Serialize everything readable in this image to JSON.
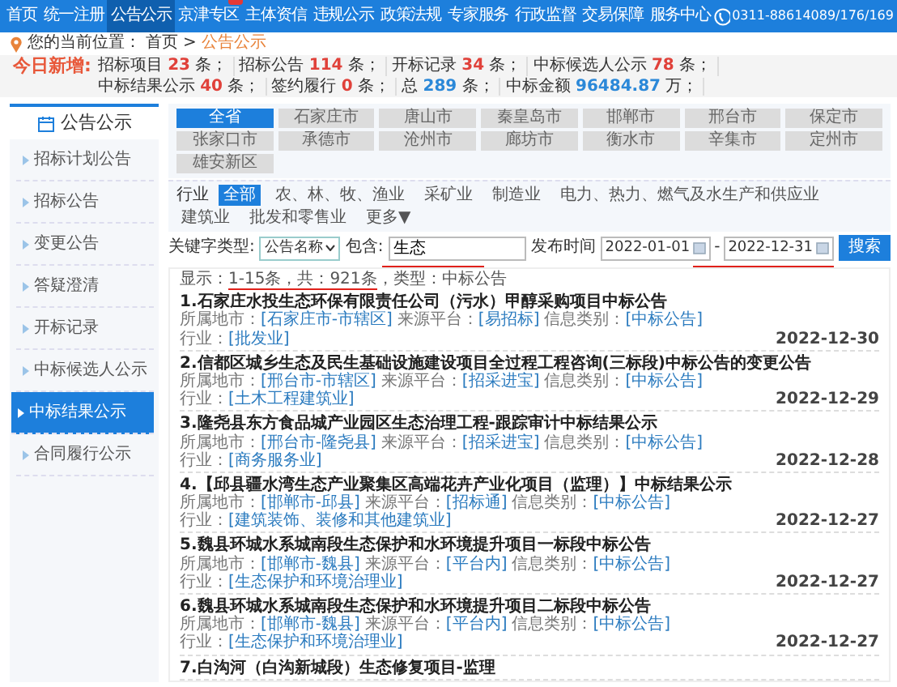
{
  "nav": {
    "items": [
      {
        "label": "首页",
        "selected": false,
        "badge": false
      },
      {
        "label": "统一注册",
        "selected": false,
        "badge": false
      },
      {
        "label": "公告公示",
        "selected": true,
        "badge": false
      },
      {
        "label": "京津专区",
        "selected": false,
        "badge": true
      },
      {
        "label": "主体资信",
        "selected": false,
        "badge": false
      },
      {
        "label": "违规公示",
        "selected": false,
        "badge": false
      },
      {
        "label": "政策法规",
        "selected": false,
        "badge": false
      },
      {
        "label": "专家服务",
        "selected": false,
        "badge": false
      },
      {
        "label": "行政监督",
        "selected": false,
        "badge": false
      },
      {
        "label": "交易保障",
        "selected": false,
        "badge": false
      },
      {
        "label": "服务中心",
        "selected": false,
        "badge": false
      }
    ],
    "phone": "0311-88614089/176/169"
  },
  "breadcrumb": {
    "label": "您的当前位置：",
    "separator": ">",
    "items": [
      {
        "label": "首页",
        "current": false
      },
      {
        "label": "公告公示",
        "current": true
      }
    ]
  },
  "stats": {
    "title": "今日新增:",
    "items": [
      {
        "label": "招标项目",
        "value": "23",
        "unit": "条；",
        "color": "#e0413a"
      },
      {
        "label": "招标公告",
        "value": "114",
        "unit": "条；",
        "color": "#e0413a"
      },
      {
        "label": "开标记录",
        "value": "34",
        "unit": "条；",
        "color": "#e0413a"
      },
      {
        "label": "中标候选人公示",
        "value": "78",
        "unit": "条；",
        "color": "#e0413a"
      },
      {
        "label": "中标结果公示",
        "value": "40",
        "unit": "条；",
        "color": "#e0413a"
      },
      {
        "label": "签约履行",
        "value": "0",
        "unit": "条；",
        "color": "#e0413a"
      },
      {
        "label": "总",
        "value": "289",
        "unit": "条；",
        "color": "#2b88d8"
      },
      {
        "label": "中标金额",
        "value": "96484.87",
        "unit": "万；",
        "color": "#2b88d8"
      }
    ]
  },
  "sidebar": {
    "title": "公告公示",
    "items": [
      {
        "label": "招标计划公告",
        "selected": false
      },
      {
        "label": "招标公告",
        "selected": false
      },
      {
        "label": "变更公告",
        "selected": false
      },
      {
        "label": "答疑澄清",
        "selected": false
      },
      {
        "label": "开标记录",
        "selected": false
      },
      {
        "label": "中标候选人公示",
        "selected": false
      },
      {
        "label": "中标结果公示",
        "selected": true
      },
      {
        "label": "合同履行公示",
        "selected": false
      }
    ]
  },
  "regions": [
    {
      "label": "全省",
      "selected": true
    },
    {
      "label": "石家庄市",
      "selected": false
    },
    {
      "label": "唐山市",
      "selected": false
    },
    {
      "label": "秦皇岛市",
      "selected": false
    },
    {
      "label": "邯郸市",
      "selected": false
    },
    {
      "label": "邢台市",
      "selected": false
    },
    {
      "label": "保定市",
      "selected": false
    },
    {
      "label": "张家口市",
      "selected": false
    },
    {
      "label": "承德市",
      "selected": false
    },
    {
      "label": "沧州市",
      "selected": false
    },
    {
      "label": "廊坊市",
      "selected": false
    },
    {
      "label": "衡水市",
      "selected": false
    },
    {
      "label": "辛集市",
      "selected": false
    },
    {
      "label": "定州市",
      "selected": false
    },
    {
      "label": "雄安新区",
      "selected": false
    }
  ],
  "industry": {
    "label": "行业",
    "more": "更多▼",
    "items": [
      {
        "label": "全部",
        "selected": true
      },
      {
        "label": "农、林、牧、渔业",
        "selected": false
      },
      {
        "label": "采矿业",
        "selected": false
      },
      {
        "label": "制造业",
        "selected": false
      },
      {
        "label": "电力、热力、燃气及水生产和供应业",
        "selected": false
      },
      {
        "label": "建筑业",
        "selected": false
      },
      {
        "label": "批发和零售业",
        "selected": false
      }
    ]
  },
  "search": {
    "keyword_type_label": "关键字类型:",
    "keyword_type": "公告名称",
    "contains_label": "包含:",
    "keyword": "生态",
    "keyword_underlined": true,
    "date_label": "发布时间",
    "date_from": "2022-01-01",
    "date_separator": "-",
    "date_to": "2022-12-31",
    "dates_underlined": true,
    "button": "搜索"
  },
  "results": {
    "summary": {
      "prefix": "显示：",
      "underlined": "1-15条，共：921条",
      "suffix": "，类型：中标公告"
    },
    "items": [
      {
        "title": "1.石家庄水投生态环保有限责任公司（污水）甲醇采购项目中标公告",
        "date": "2022-12-30",
        "meta": [
          {
            "label": "所属地市：",
            "value": "[石家庄市-市辖区]"
          },
          {
            "label": "来源平台：",
            "value": "[易招标]"
          },
          {
            "label": "信息类别：",
            "value": "[中标公告]"
          },
          {
            "label": "行业：",
            "value": "[批发业]"
          }
        ]
      },
      {
        "title": "2.信都区城乡生态及民生基础设施建设项目全过程工程咨询(三标段)中标公告的变更公告",
        "date": "2022-12-29",
        "meta": [
          {
            "label": "所属地市：",
            "value": "[邢台市-市辖区]"
          },
          {
            "label": "来源平台：",
            "value": "[招采进宝]"
          },
          {
            "label": "信息类别：",
            "value": "[中标公告]"
          },
          {
            "label": "行业：",
            "value": "[土木工程建筑业]"
          }
        ]
      },
      {
        "title": "3.隆尧县东方食品城产业园区生态治理工程-跟踪审计中标结果公示",
        "date": "2022-12-28",
        "meta": [
          {
            "label": "所属地市：",
            "value": "[邢台市-隆尧县]"
          },
          {
            "label": "来源平台：",
            "value": "[招采进宝]"
          },
          {
            "label": "信息类别：",
            "value": "[中标公告]"
          },
          {
            "label": "行业：",
            "value": "[商务服务业]"
          }
        ]
      },
      {
        "title": "4.【邱县疆水湾生态产业聚集区高端花卉产业化项目（监理）】中标结果公示",
        "date": "2022-12-27",
        "meta": [
          {
            "label": "所属地市：",
            "value": "[邯郸市-邱县]"
          },
          {
            "label": "来源平台：",
            "value": "[招标通]"
          },
          {
            "label": "信息类别：",
            "value": "[中标公告]"
          },
          {
            "label": "行业：",
            "value": "[建筑装饰、装修和其他建筑业]"
          }
        ]
      },
      {
        "title": "5.魏县环城水系城南段生态保护和水环境提升项目一标段中标公告",
        "date": "2022-12-27",
        "meta": [
          {
            "label": "所属地市：",
            "value": "[邯郸市-魏县]"
          },
          {
            "label": "来源平台：",
            "value": "[平台内]"
          },
          {
            "label": "信息类别：",
            "value": "[中标公告]"
          },
          {
            "label": "行业：",
            "value": "[生态保护和环境治理业]"
          }
        ]
      },
      {
        "title": "6.魏县环城水系城南段生态保护和水环境提升项目二标段中标公告",
        "date": "2022-12-27",
        "meta": [
          {
            "label": "所属地市：",
            "value": "[邯郸市-魏县]"
          },
          {
            "label": "来源平台：",
            "value": "[平台内]"
          },
          {
            "label": "信息类别：",
            "value": "[中标公告]"
          },
          {
            "label": "行业：",
            "value": "[生态保护和环境治理业]"
          }
        ]
      },
      {
        "title": "7.白沟河（白沟新城段）生态修复项目-监理"
      }
    ]
  }
}
